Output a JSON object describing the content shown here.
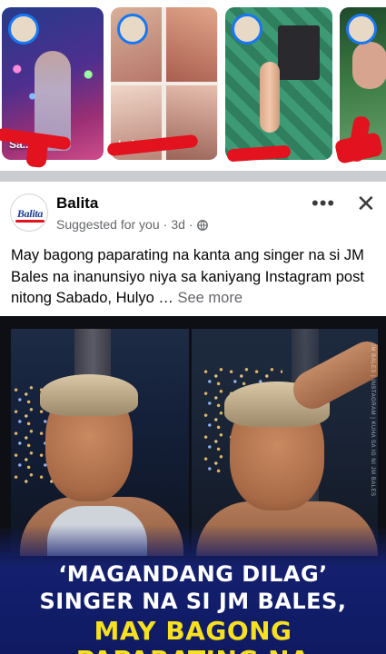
{
  "stories": [
    {
      "caption": "Sa..."
    },
    {
      "caption": "Lola..."
    },
    {
      "caption": ""
    },
    {
      "caption": ""
    }
  ],
  "post": {
    "page_name": "Balita",
    "logo_text": "Balita",
    "suggested_label": "Suggested for you",
    "separator": "·",
    "time": "3d",
    "separator2": "·",
    "more_icon": "more-horizontal-icon",
    "close_icon": "close-icon",
    "text": "May bagong paparating na kanta ang singer na si JM Bales na inanunsiyo niya sa kaniyang Instagram post nitong Sabado, Hulyo …",
    "see_more": "See more",
    "image_headline": {
      "line1": "‘MAGANDANG DILAG’",
      "line2": "SINGER NA SI JM BALES,",
      "line3": "MAY BAGONG",
      "line4": "PAPARATING NA"
    },
    "watermark": "JM BALES | INSTAGRAM | KUHA SA IG NI JM BALES"
  },
  "colors": {
    "accent": "#1877f2",
    "scribble": "#e2121f",
    "headline_yellow": "#f6e020",
    "headline_bg": "#14206e"
  }
}
